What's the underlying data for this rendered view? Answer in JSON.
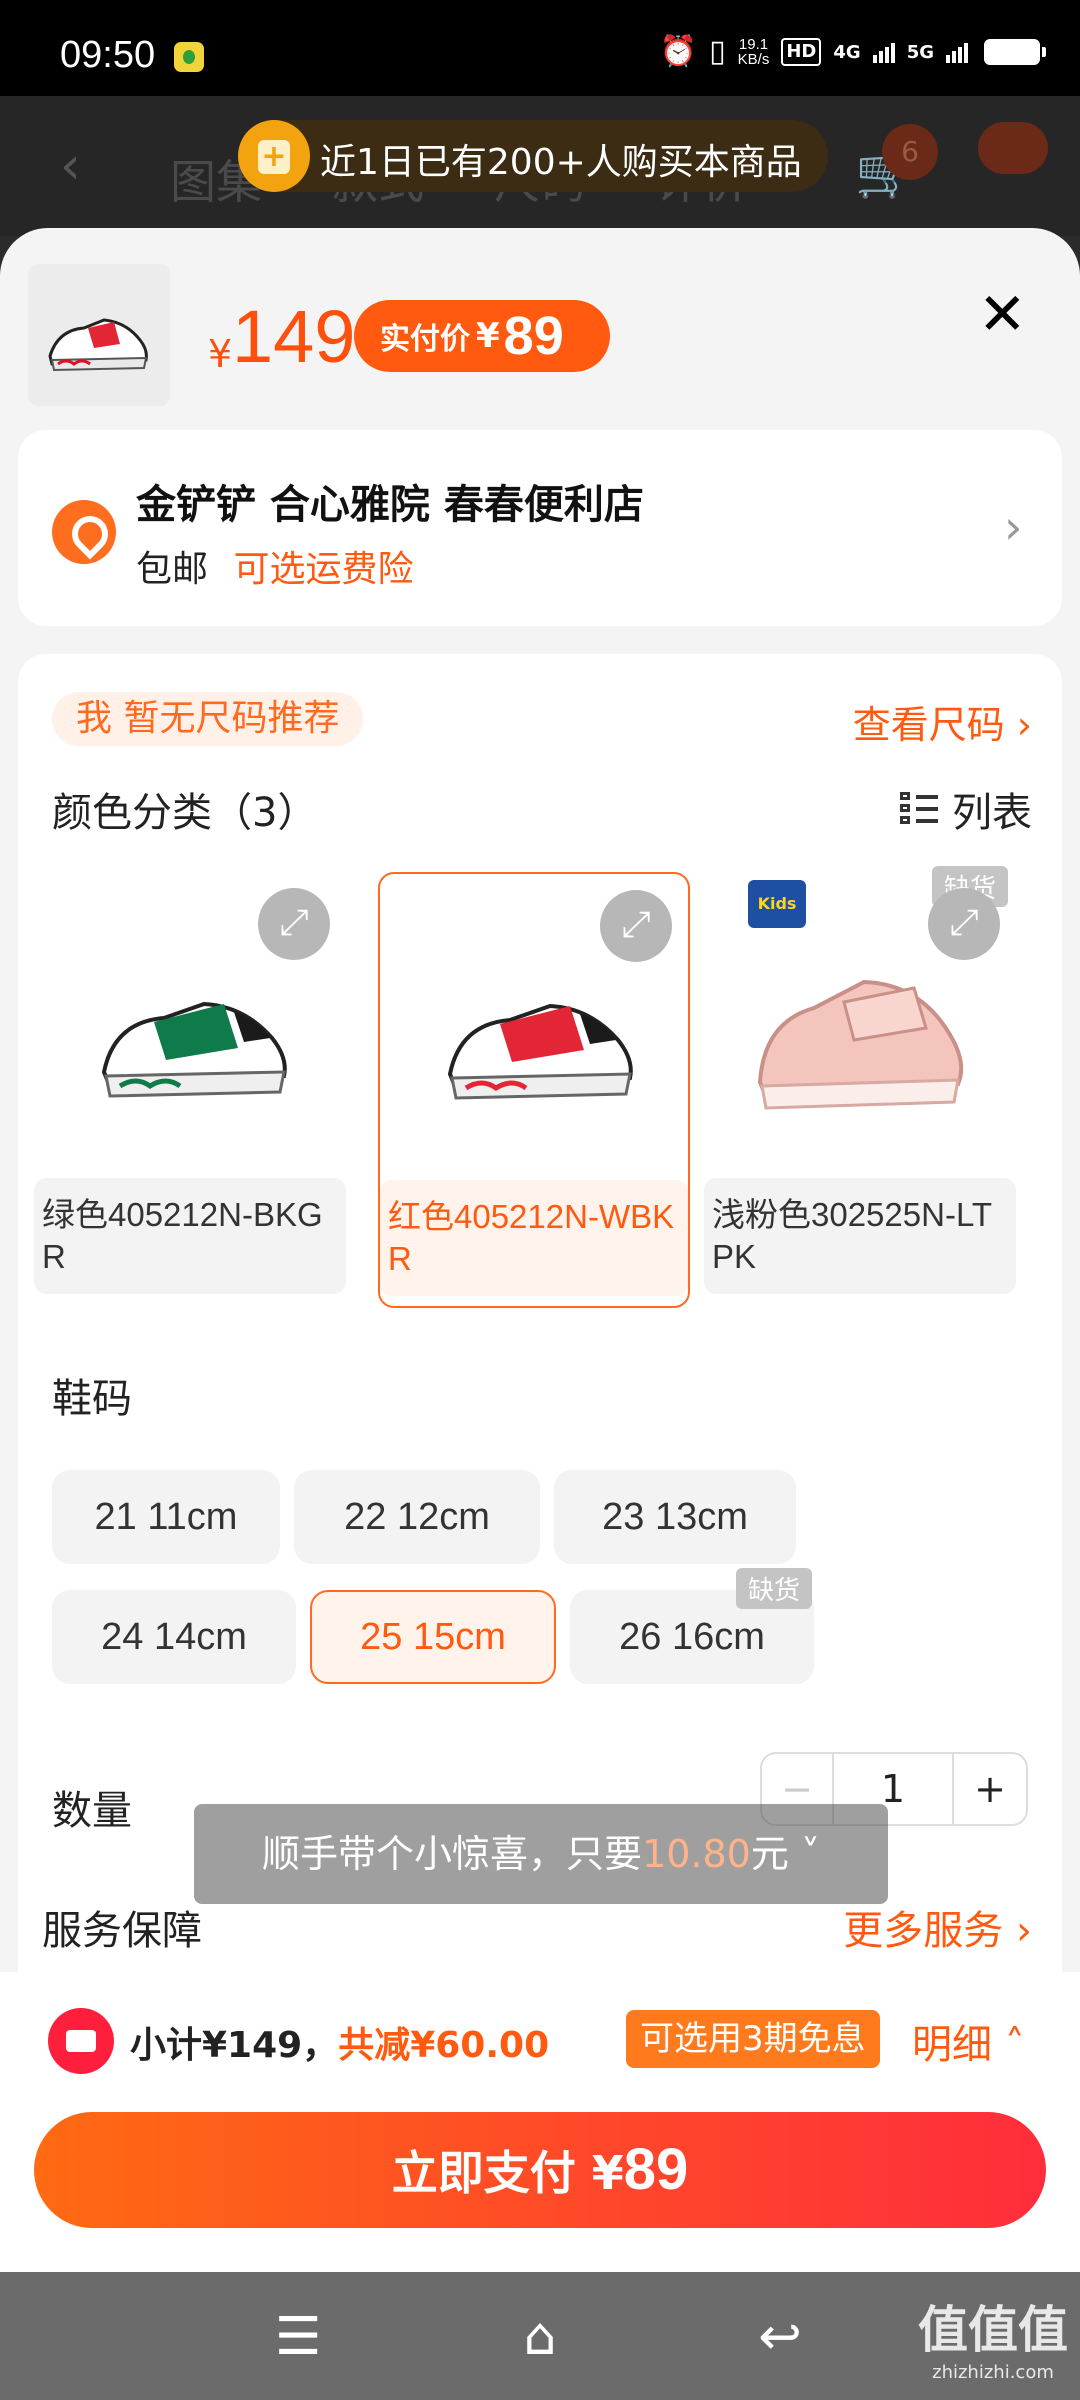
{
  "status_bar": {
    "time": "09:50",
    "net_speed_value": "19.1",
    "net_speed_unit": "KB/s",
    "hd_label": "HD",
    "net1": "4G",
    "net2": "5G",
    "icons": [
      "alarm-icon",
      "vibrate-icon",
      "signal-icon",
      "battery-icon"
    ]
  },
  "background_header": {
    "tabs": [
      "图集",
      "款式",
      "尺码",
      "评价"
    ],
    "cart_badge": "6"
  },
  "promo_banner": {
    "text": "近1日已有200+人购买本商品"
  },
  "product": {
    "currency": "¥",
    "price": "149",
    "pay_label": "实付价",
    "pay_currency": "¥",
    "pay_price": "89"
  },
  "store": {
    "name": "金铲铲 合心雅院 春春便利店",
    "shipping": "包邮",
    "insurance": "可选运费险"
  },
  "size_tip": "我 暂无尺码推荐",
  "view_size": "查看尺码 ›",
  "colors": {
    "title": "颜色分类（3）",
    "list_label": "列表",
    "items": [
      {
        "label": "绿色405212N-BKGR",
        "selected": false,
        "out_of_stock": false
      },
      {
        "label": "红色405212N-WBKR",
        "selected": true,
        "out_of_stock": false
      },
      {
        "label": "浅粉色302525N-LTPK",
        "selected": false,
        "out_of_stock": true
      }
    ],
    "out_of_stock_label": "缺货",
    "brand_logo_text": "Kids"
  },
  "sizes": {
    "title": "鞋码",
    "items": [
      {
        "label": "21 11cm",
        "selected": false
      },
      {
        "label": "22 12cm",
        "selected": false
      },
      {
        "label": "23 13cm",
        "selected": false
      },
      {
        "label": "24 14cm",
        "selected": false
      },
      {
        "label": "25 15cm",
        "selected": true
      },
      {
        "label": "26 16cm",
        "selected": false,
        "out_of_stock": true
      }
    ],
    "out_of_stock_label": "缺货"
  },
  "quantity": {
    "title": "数量",
    "minus": "−",
    "value": "1",
    "plus": "+"
  },
  "service": {
    "title": "服务保障",
    "more": "更多服务 ›"
  },
  "toast": {
    "prefix": "顺手带个小惊喜，只要",
    "amount": "10.80",
    "suffix": "元 ˅"
  },
  "summary": {
    "subtotal": "小计¥149，",
    "discount": "共减¥60.00",
    "installment": "可选用3期免息",
    "detail": "明细 ˄"
  },
  "pay_button": {
    "label": "立即支付 ",
    "currency": "¥",
    "amount": "89"
  },
  "nav": {
    "menu": "☰",
    "home": "⌂",
    "back": "↩"
  },
  "watermark": {
    "big": "值值值",
    "small": "zhizhizhi.com"
  },
  "colors_theme": {
    "accent": "#ff5a0f",
    "accent_light": "#fff3ec",
    "pay_gradient_start": "#ff6a12",
    "pay_gradient_end": "#ff2d3c"
  }
}
